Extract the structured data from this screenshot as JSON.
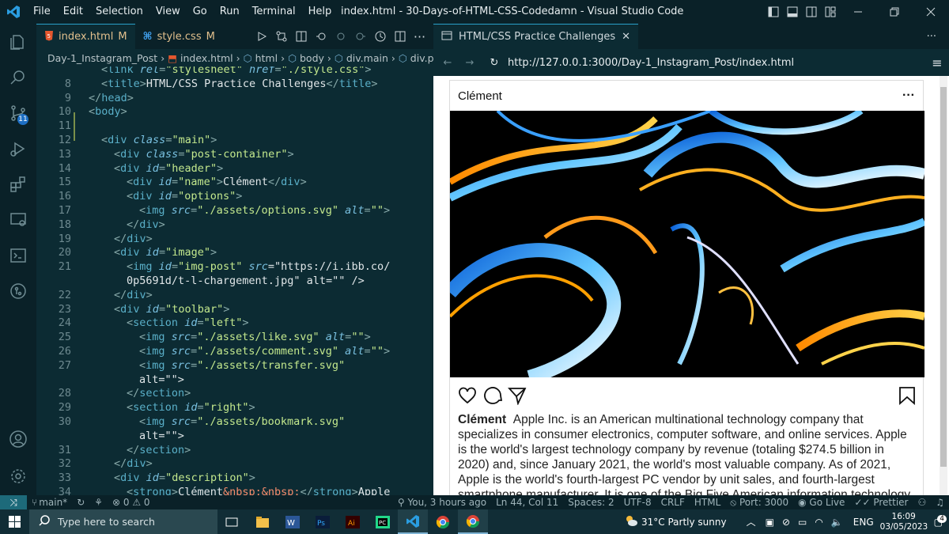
{
  "window": {
    "title": "index.html - 30-Days-of-HTML-CSS-Codedamn - Visual Studio Code"
  },
  "menu": [
    "File",
    "Edit",
    "Selection",
    "View",
    "Go",
    "Run",
    "Terminal",
    "Help"
  ],
  "tabs": [
    {
      "label": "index.html",
      "status": "M"
    },
    {
      "label": "style.css",
      "status": "M"
    }
  ],
  "breadcrumb": [
    "Day-1_Instagram_Post",
    "index.html",
    "html",
    "body",
    "div.main",
    "div.post-"
  ],
  "activity_badge": "11",
  "code_lines": [
    {
      "n": "",
      "text": "<link rel=\"stylesheet\" href=\"./style.css\">"
    },
    {
      "n": "8",
      "text": "<title>HTML/CSS Practice Challenges</title>"
    },
    {
      "n": "9",
      "text": "</head>"
    },
    {
      "n": "10",
      "text": "<body>"
    },
    {
      "n": "11",
      "text": ""
    },
    {
      "n": "12",
      "text": "<div class=\"main\">"
    },
    {
      "n": "13",
      "text": "<div class=\"post-container\">"
    },
    {
      "n": "14",
      "text": "<div id=\"header\">"
    },
    {
      "n": "15",
      "text": "<div id=\"name\">Clément</div>"
    },
    {
      "n": "16",
      "text": "<div id=\"options\">"
    },
    {
      "n": "17",
      "text": "<img src=\"./assets/options.svg\" alt=\"\">"
    },
    {
      "n": "18",
      "text": "</div>"
    },
    {
      "n": "19",
      "text": "</div>"
    },
    {
      "n": "20",
      "text": "<div id=\"image\">"
    },
    {
      "n": "21",
      "text": "<img id=\"img-post\" src=\"https://i.ibb.co/"
    },
    {
      "n": "",
      "text": "0p5691d/t-l-chargement.jpg\" alt=\"\" />"
    },
    {
      "n": "22",
      "text": "</div>"
    },
    {
      "n": "23",
      "text": "<div id=\"toolbar\">"
    },
    {
      "n": "24",
      "text": "<section id=\"left\">"
    },
    {
      "n": "25",
      "text": "<img src=\"./assets/like.svg\" alt=\"\">"
    },
    {
      "n": "26",
      "text": "<img src=\"./assets/comment.svg\" alt=\"\">"
    },
    {
      "n": "27",
      "text": "<img src=\"./assets/transfer.svg\""
    },
    {
      "n": "",
      "text": "alt=\"\">"
    },
    {
      "n": "28",
      "text": "</section>"
    },
    {
      "n": "29",
      "text": "<section id=\"right\">"
    },
    {
      "n": "30",
      "text": "<img src=\"./assets/bookmark.svg\""
    },
    {
      "n": "",
      "text": "alt=\"\">"
    },
    {
      "n": "31",
      "text": "</section>"
    },
    {
      "n": "32",
      "text": "</div>"
    },
    {
      "n": "33",
      "text": "<div id=\"description\">"
    },
    {
      "n": "34",
      "text": "<strong>Clément&nbsp;&nbsp;</strong>Apple"
    }
  ],
  "preview": {
    "tab_title": "HTML/CSS Practice Challenges",
    "url": "http://127.0.0.1:3000/Day-1_Instagram_Post/index.html",
    "post": {
      "name": "Clément",
      "options": "···",
      "desc_name": "Clément",
      "description": "Apple Inc. is an American multinational technology company that specializes in consumer electronics, computer software, and online services. Apple is the world's largest technology company by revenue (totaling $274.5 billion in 2020) and, since January 2021, the world's most valuable company. As of 2021, Apple is the world's fourth-largest PC vendor by unit sales, and fourth-largest smartphone manufacturer. It is one of the Big Five American information technology companies, along with Amazon, Google, Microsoft, and"
    }
  },
  "status": {
    "branch": "main*",
    "problems": "0",
    "warnings": "0",
    "blame": "You, 3 hours ago",
    "position": "Ln 44, Col 11",
    "spaces": "Spaces: 2",
    "encoding": "UTF-8",
    "eol": "CRLF",
    "language": "HTML",
    "port": "Port: 3000",
    "golive": "Go Live",
    "prettier": "Prettier"
  },
  "taskbar": {
    "search_placeholder": "Type here to search",
    "weather": "31°C  Partly sunny",
    "lang": "ENG",
    "time": "16:09",
    "date": "03/05/2023",
    "notif_count": "4"
  },
  "colors": {
    "editor_bg": "#0c2b33",
    "chrome_bg": "#0a2128",
    "accent": "#29a0c8"
  }
}
